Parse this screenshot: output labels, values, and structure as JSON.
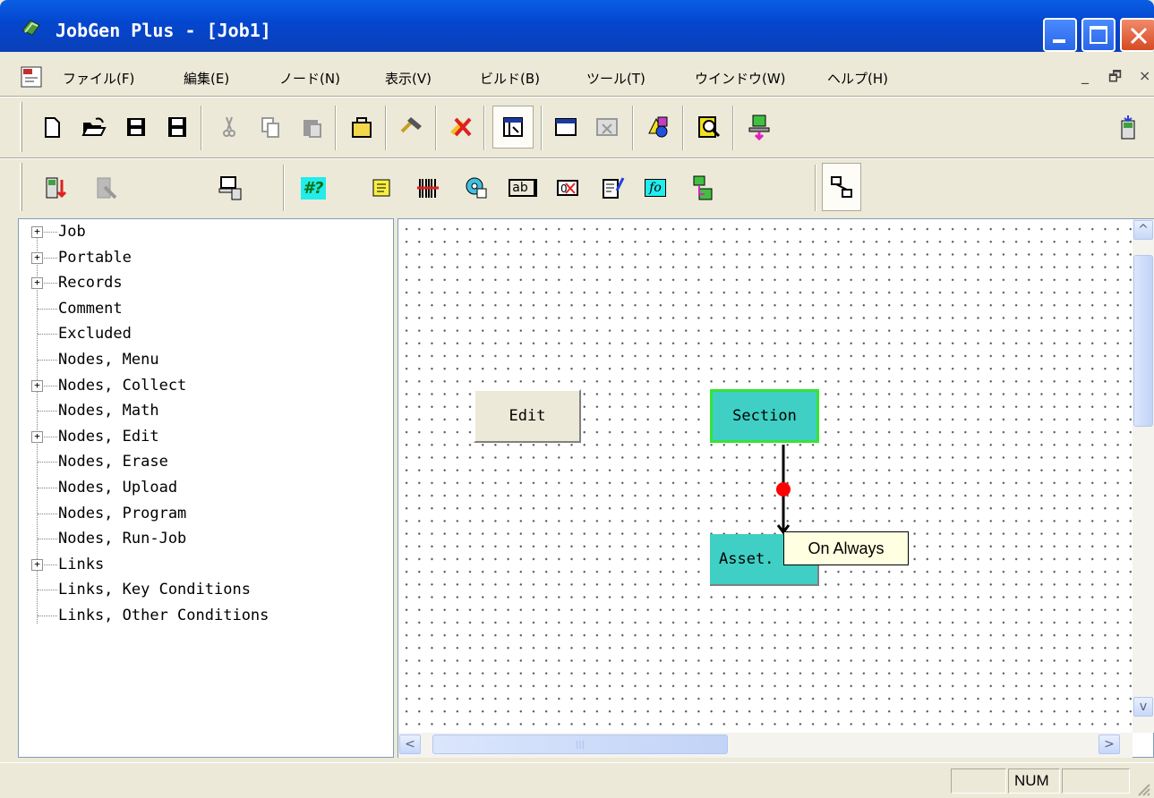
{
  "window": {
    "title": "JobGen Plus - [Job1]"
  },
  "menu": {
    "items": [
      "ファイル(F)",
      "編集(E)",
      "ノード(N)",
      "表示(V)",
      "ビルド(B)",
      "ツール(T)",
      "ウインドウ(W)",
      "ヘルプ(H)"
    ]
  },
  "toolbar1": {
    "icons": [
      "new-file-icon",
      "open-folder-icon",
      "save-icon",
      "save-all-icon",
      "cut-icon",
      "copy-icon",
      "paste-icon",
      "job-box-icon",
      "build-hammer-icon",
      "clear-build-icon",
      "tree-view-icon",
      "window-icon",
      "close-window-icon",
      "shapes-icon",
      "find-icon",
      "transfer-icon",
      "device-icon"
    ]
  },
  "toolbar2": {
    "icons": [
      "device-download-icon",
      "device-disabled-icon",
      "computer-device-icon",
      "prompt-node-icon",
      "text-node-icon",
      "barcode-node-icon",
      "disk-node-icon",
      "ab-node-icon",
      "erase-node-icon",
      "edit-node-icon",
      "fo-node-icon",
      "program-node-icon",
      "link-tool-icon"
    ],
    "prompt_label": "#?",
    "ab_label": "ab",
    "fo_label": "fo"
  },
  "tree": {
    "items": [
      {
        "label": "Job",
        "expandable": true
      },
      {
        "label": "Portable",
        "expandable": true
      },
      {
        "label": "Records",
        "expandable": true
      },
      {
        "label": "Comment",
        "expandable": false
      },
      {
        "label": "Excluded",
        "expandable": false
      },
      {
        "label": "Nodes, Menu",
        "expandable": false
      },
      {
        "label": "Nodes, Collect",
        "expandable": true
      },
      {
        "label": "Nodes, Math",
        "expandable": false
      },
      {
        "label": "Nodes, Edit",
        "expandable": true
      },
      {
        "label": "Nodes, Erase",
        "expandable": false
      },
      {
        "label": "Nodes, Upload",
        "expandable": false
      },
      {
        "label": "Nodes, Program",
        "expandable": false
      },
      {
        "label": "Nodes, Run-Job",
        "expandable": false
      },
      {
        "label": "Links",
        "expandable": true
      },
      {
        "label": "Links, Key Conditions",
        "expandable": false
      },
      {
        "label": "Links, Other Conditions",
        "expandable": false
      }
    ],
    "expander_symbol": "+"
  },
  "canvas": {
    "nodes": {
      "edit": "Edit",
      "section": "Section",
      "asset": "Asset."
    },
    "tooltip": "On Always",
    "link_dot_color": "#ff0000",
    "node_color": "#3fcfc4",
    "selected_border_color": "#37e337"
  },
  "status": {
    "panel1": "",
    "panel2": "NUM",
    "panel3": ""
  },
  "scroll": {
    "left_arrow": "<",
    "right_arrow": ">",
    "up_arrow": "^",
    "down_arrow": "v",
    "thumb_grip": "|||"
  },
  "mdi": {
    "minimize": "_",
    "restore": "🗗",
    "close": "×"
  }
}
